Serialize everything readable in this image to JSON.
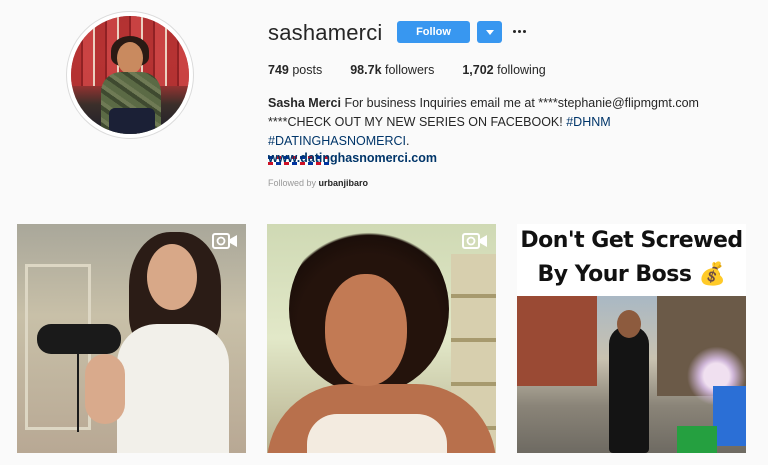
{
  "profile": {
    "username": "sashamerci",
    "follow_label": "Follow",
    "stats": [
      {
        "count": "749",
        "label": "posts"
      },
      {
        "count": "98.7k",
        "label": "followers"
      },
      {
        "count": "1,702",
        "label": "following"
      }
    ],
    "bio": {
      "name": "Sasha Merci",
      "line1": " For business Inquiries email me at ****stephanie@flipmgmt.com",
      "line2_prefix": "****CHECK OUT MY NEW SERIES ON FACEBOOK! ",
      "tag1": "#DHNM",
      "tag2": "#DATINGHASNOMERCI",
      "line2_suffix": ".",
      "flags": [
        "dominican-flag",
        "dominican-flag",
        "dominican-flag",
        "dominican-flag"
      ]
    },
    "website": "www.datinghasnomerci.com",
    "followed_by_prefix": "Followed by ",
    "followed_by_user": "urbanjibaro"
  },
  "posts": [
    {
      "type": "video"
    },
    {
      "type": "video"
    },
    {
      "type": "image",
      "line1": "Don't Get Screwed",
      "line2": "By Your Boss 💰"
    }
  ],
  "colors": {
    "accent": "#3897f0",
    "link": "#003569",
    "background": "#fafafa"
  }
}
